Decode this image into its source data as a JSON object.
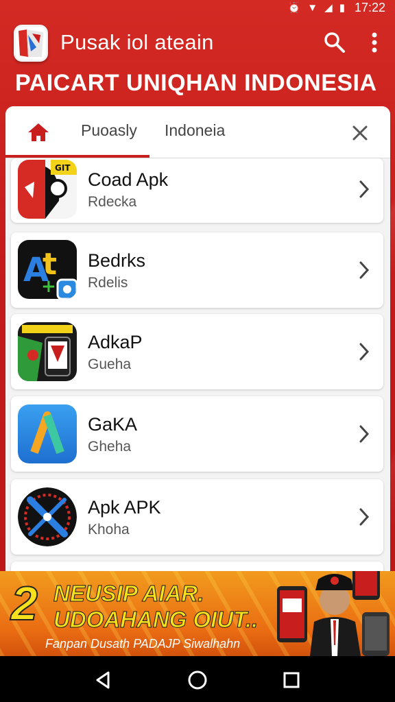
{
  "status_bar": {
    "time": "17:22"
  },
  "app_bar": {
    "title": "Pusak iol ateain",
    "search_icon": "search-icon",
    "more_icon": "more-vert-icon"
  },
  "banner": {
    "title": "PAICART UNIQHAN INDONESIA"
  },
  "tabs": [
    {
      "label": "",
      "icon": "home-icon",
      "selected": true
    },
    {
      "label": "Puoasly"
    },
    {
      "label": "Indoneia"
    },
    {
      "label": "",
      "icon": "close-icon"
    }
  ],
  "apps": [
    {
      "name": "Coad Apk",
      "subtitle": "Rdecka"
    },
    {
      "name": "Bedrks",
      "subtitle": "Rdelis"
    },
    {
      "name": "AdkaP",
      "subtitle": "Gueha"
    },
    {
      "name": "GaKA",
      "subtitle": "Gheha"
    },
    {
      "name": "Apk APK",
      "subtitle": "Khoha"
    }
  ],
  "promo": {
    "number": "2",
    "line1": "NEUSIP AIAR.",
    "line2": "UDOAHANG OIUT..",
    "caption": "Fanpan Dusath PADAJP Siwalhahn"
  },
  "colors": {
    "primary_red": "#c81e1e",
    "promo_orange": "#ea6c12",
    "promo_yellow": "#f7e11c"
  }
}
